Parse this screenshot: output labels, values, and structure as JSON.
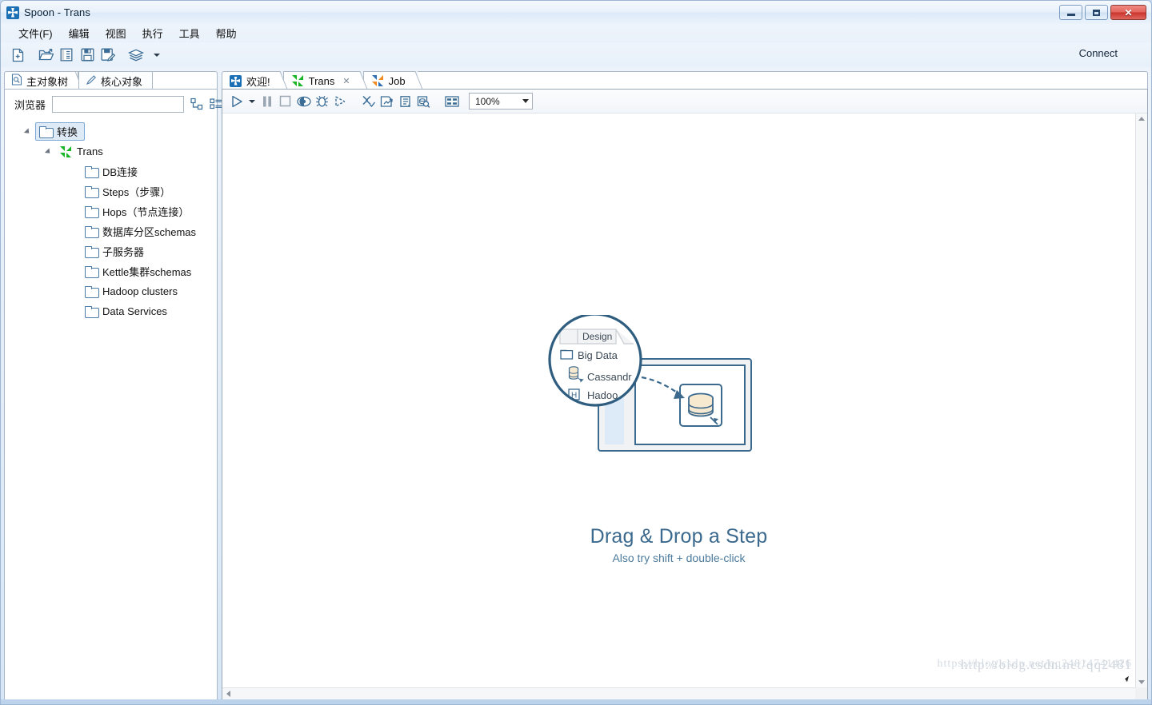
{
  "window": {
    "title": "Spoon - Trans",
    "app_icon": "spoon-icon",
    "minimize_label": "",
    "maximize_label": "",
    "close_label": "✕"
  },
  "menubar": {
    "items": [
      {
        "label": "文件(F)",
        "name": "menu-file"
      },
      {
        "label": "编辑",
        "name": "menu-edit"
      },
      {
        "label": "视图",
        "name": "menu-view"
      },
      {
        "label": "执行",
        "name": "menu-run"
      },
      {
        "label": "工具",
        "name": "menu-tools"
      },
      {
        "label": "帮助",
        "name": "menu-help"
      }
    ]
  },
  "toolbar": {
    "icons": [
      {
        "name": "new-file-icon",
        "title": "新建"
      },
      {
        "name": "open-file-icon",
        "title": "打开"
      },
      {
        "name": "explorer-icon",
        "title": "资源库浏览器"
      },
      {
        "name": "save-icon",
        "title": "保存"
      },
      {
        "name": "save-as-icon",
        "title": "另存为"
      },
      {
        "name": "layers-icon",
        "title": "视图层"
      },
      {
        "name": "dropdown-caret-icon",
        "title": ""
      }
    ],
    "connect_label": "Connect"
  },
  "sidebar": {
    "tabs": [
      {
        "label": "主对象树",
        "icon": "document-search-icon",
        "active": true
      },
      {
        "label": "核心对象",
        "icon": "pencil-icon",
        "active": false
      }
    ],
    "browser": {
      "label": "浏览器",
      "value": "",
      "placeholder": ""
    },
    "browser_buttons": [
      {
        "name": "collapse-tree-icon"
      },
      {
        "name": "list-view-icon"
      }
    ],
    "tree": {
      "root": {
        "label": "转换",
        "icon": "folder-icon",
        "selected": true,
        "expanded": true
      },
      "child": {
        "label": "Trans",
        "icon": "trans-icon",
        "expanded": true
      },
      "items": [
        {
          "label": "DB连接",
          "icon": "folder-icon"
        },
        {
          "label": "Steps（步骤）",
          "icon": "folder-icon"
        },
        {
          "label": "Hops（节点连接）",
          "icon": "folder-icon"
        },
        {
          "label": "数据库分区schemas",
          "icon": "folder-icon"
        },
        {
          "label": "子服务器",
          "icon": "folder-icon"
        },
        {
          "label": "Kettle集群schemas",
          "icon": "folder-icon"
        },
        {
          "label": "Hadoop clusters",
          "icon": "folder-icon"
        },
        {
          "label": "Data Services",
          "icon": "folder-icon"
        }
      ]
    }
  },
  "editor": {
    "tabs": [
      {
        "label": "欢迎!",
        "icon": "spoon-icon",
        "active": false,
        "closable": false
      },
      {
        "label": "Trans",
        "icon": "trans-icon",
        "active": true,
        "closable": true,
        "close_glyph": "✕"
      },
      {
        "label": "Job",
        "icon": "job-icon",
        "active": false,
        "closable": false
      }
    ],
    "toolbar_icons": [
      {
        "name": "run-icon",
        "title": "运行"
      },
      {
        "name": "run-dropdown-caret-icon",
        "title": ""
      },
      {
        "name": "pause-icon",
        "title": "暂停"
      },
      {
        "name": "stop-icon",
        "title": "停止"
      },
      {
        "name": "preview-icon",
        "title": "预览"
      },
      {
        "name": "debug-icon",
        "title": "调试"
      },
      {
        "name": "replay-icon",
        "title": "重放"
      },
      {
        "name": "verify-icon",
        "title": "检验这个转换"
      },
      {
        "name": "analyze-impact-icon",
        "title": "运行此转换的影响分析"
      },
      {
        "name": "generate-sql-icon",
        "title": "生成SQL"
      },
      {
        "name": "explore-db-icon",
        "title": "浏览数据库"
      },
      {
        "name": "show-grid-icon",
        "title": "显示栅格"
      }
    ],
    "zoom": {
      "value": "100%",
      "caret": "chevron-down-icon"
    }
  },
  "canvas": {
    "illustration": {
      "popup_tab_label": "Design",
      "entries": [
        {
          "label": "Big Data",
          "icon": "folder-icon"
        },
        {
          "label": "Cassandr",
          "icon": "database-icon"
        },
        {
          "label": "Hadoo",
          "icon": "hadoop-icon",
          "badge": "H"
        }
      ]
    },
    "title": "Drag & Drop a Step",
    "subtitle": "Also try shift + double-click"
  },
  "watermark": {
    "line1": "http://blog.csdn.net/qq2481",
    "line2": "https://blog.csdn.net/qq24814741426"
  },
  "colors": {
    "accent": "#3c6a8e",
    "tree_selection": "#dfeaf7",
    "trans_green": "#18b527",
    "job_orange": "#f08a20",
    "spoon_blue": "#1a6fb5",
    "titlebar": "#e9f1fa",
    "close_red": "#c9342c"
  }
}
